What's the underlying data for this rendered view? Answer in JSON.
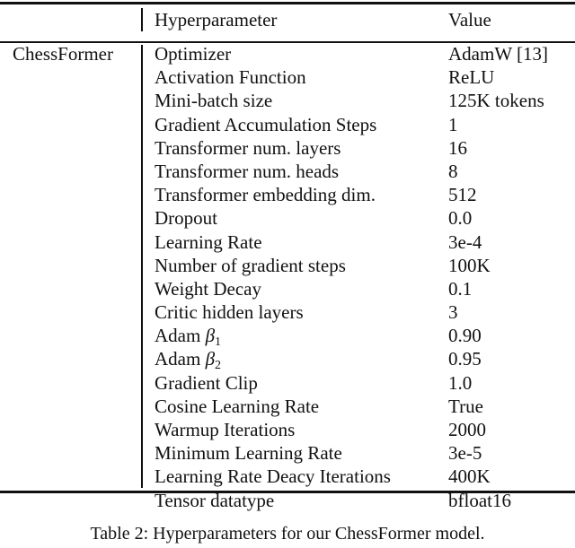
{
  "table": {
    "header": {
      "model_col": "",
      "param_col": "Hyperparameter",
      "value_col": "Value"
    },
    "model_name": "ChessFormer",
    "rows": [
      {
        "param": "Optimizer",
        "value": "AdamW [13]"
      },
      {
        "param": "Activation Function",
        "value": "ReLU"
      },
      {
        "param": "Mini-batch size",
        "value": "125K tokens"
      },
      {
        "param": "Gradient Accumulation Steps",
        "value": "1"
      },
      {
        "param": "Transformer num. layers",
        "value": "16"
      },
      {
        "param": "Transformer num. heads",
        "value": "8"
      },
      {
        "param": "Transformer embedding dim.",
        "value": "512"
      },
      {
        "param": "Dropout",
        "value": "0.0"
      },
      {
        "param": "Learning Rate",
        "value": "3e-4"
      },
      {
        "param": "Number of gradient steps",
        "value": "100K"
      },
      {
        "param": "Weight Decay",
        "value": "0.1"
      },
      {
        "param": "Critic hidden layers",
        "value": "3"
      },
      {
        "param": "Adam",
        "symbol": "β",
        "subscript": "1",
        "value": "0.90"
      },
      {
        "param": "Adam",
        "symbol": "β",
        "subscript": "2",
        "value": "0.95"
      },
      {
        "param": "Gradient Clip",
        "value": "1.0"
      },
      {
        "param": "Cosine Learning Rate",
        "value": "True"
      },
      {
        "param": "Warmup Iterations",
        "value": "2000"
      },
      {
        "param": "Minimum Learning Rate",
        "value": "3e-5"
      },
      {
        "param": "Learning Rate Deacy Iterations",
        "value": "400K"
      },
      {
        "param": "Tensor datatype",
        "value": "bfloat16"
      }
    ]
  },
  "caption": "Table 2: Hyperparameters for our ChessFormer model."
}
